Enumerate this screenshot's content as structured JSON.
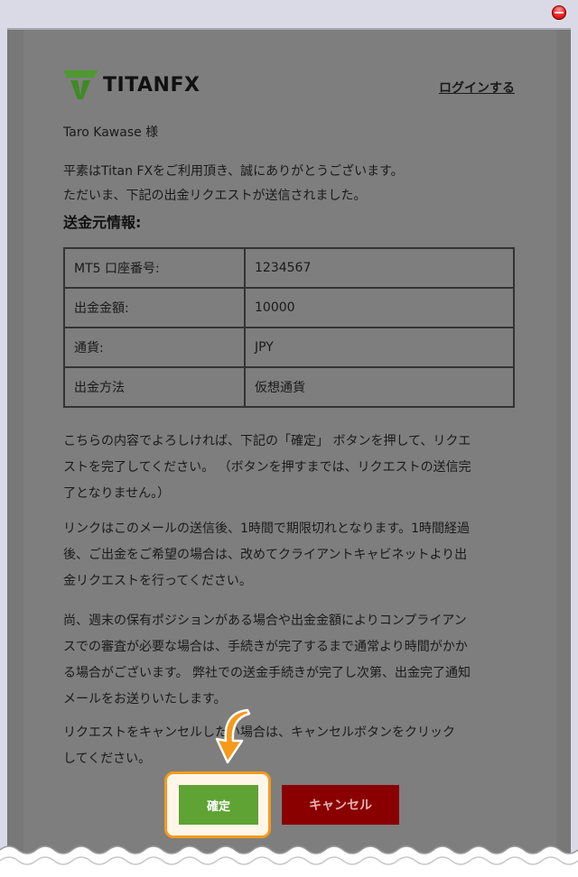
{
  "header": {
    "logo_text_a": "TITAN",
    "logo_text_b": "FX",
    "login_link": "ログインする"
  },
  "body": {
    "greeting": "Taro Kawase 様",
    "line1": "平素はTitan FXをご利用頂き、誠にありがとうございます。",
    "line2": "ただいま、下記の出金リクエストが送信されました。",
    "section_title": "送金元情報:",
    "table": [
      {
        "label": "MT5 口座番号:",
        "value": "1234567"
      },
      {
        "label": "出金金額:",
        "value": "10000"
      },
      {
        "label": "通貨:",
        "value": "JPY"
      },
      {
        "label": "出金方法",
        "value": "仮想通貨"
      }
    ],
    "para1": [
      "こちらの内容でよろしければ、下記の「確定」 ボタンを押して、リクエ",
      "ストを完了してください。 （ボタンを押すまでは、リクエストの送信完",
      "了となりません。）"
    ],
    "para2": [
      "リンクはこのメールの送信後、1時間で期限切れとなります。1時間経過",
      "後、ご出金をご希望の場合は、改めてクライアントキャビネットより出",
      "金リクエストを行ってください。"
    ],
    "para3": [
      "尚、週末の保有ポジションがある場合や出金金額によりコンプライアン",
      "スでの審査が必要な場合は、手続きが完了するまで通常より時間がかか",
      "る場合がございます。 弊社での送金手続きが完了し次第、出金完了通知",
      "メールをお送りいたします。"
    ],
    "para4": [
      "リクエストをキャンセルしたい場合は、キャンセルボタンをクリック",
      "してください。"
    ]
  },
  "buttons": {
    "confirm": "確定",
    "cancel": "キャンセル"
  },
  "colors": {
    "confirm_bg": "#5ea334",
    "cancel_bg": "#8a0000",
    "highlight": "#f59a1b",
    "logo_green": "#4e9a2f"
  }
}
